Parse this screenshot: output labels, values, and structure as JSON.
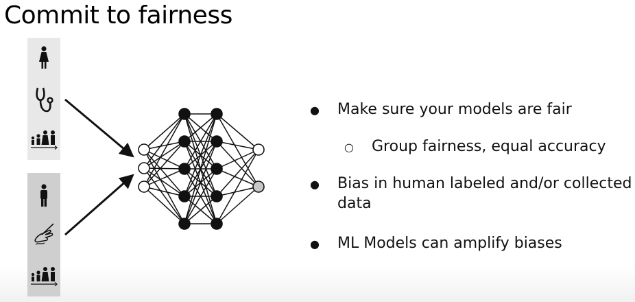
{
  "slide": {
    "title": "Commit to fairness"
  },
  "bullets": [
    {
      "level": 1,
      "text": "Make sure your models are fair"
    },
    {
      "level": 2,
      "text": "Group fairness, equal accuracy"
    },
    {
      "level": 1,
      "text": "Bias in human labeled and/or collected data"
    },
    {
      "level": 1,
      "text": "ML Models can amplify biases"
    }
  ],
  "icons": {
    "top_panel": [
      "woman-icon",
      "stethoscope-icon",
      "family-icon"
    ],
    "bottom_panel": [
      "man-icon",
      "hand-writing-icon",
      "family-icon"
    ]
  },
  "network": {
    "layers": [
      3,
      5,
      5,
      2
    ]
  },
  "colors": {
    "top_panel": "#e8e8e8",
    "bottom_panel": "#cfcfcf",
    "gray_node": "#c8c8c8"
  }
}
